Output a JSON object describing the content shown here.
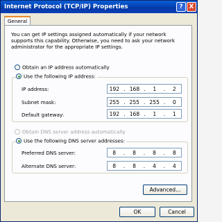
{
  "window": {
    "title": "Internet Protocol (TCP/IP) Properties",
    "help_label": "?",
    "close_label": "X"
  },
  "tabs": [
    {
      "label": "General"
    }
  ],
  "info_text": "You can get IP settings assigned automatically if your network supports this capability. Otherwise, you need to ask your network administrator for the appropriate IP settings.",
  "ip": {
    "auto_label": "Obtain an IP address automatically",
    "manual_label": "Use the following IP address:",
    "selected": "manual",
    "fields": [
      {
        "label": "IP address:",
        "octets": [
          "192",
          "168",
          "1",
          "2"
        ]
      },
      {
        "label": "Subnet mask:",
        "octets": [
          "255",
          "255",
          "255",
          "0"
        ]
      },
      {
        "label": "Default gateway:",
        "octets": [
          "192",
          "168",
          "1",
          "1"
        ]
      }
    ]
  },
  "dns": {
    "auto_label": "Obtain DNS server address automatically",
    "manual_label": "Use the following DNS server addresses:",
    "selected": "manual",
    "fields": [
      {
        "label": "Preferred DNS server:",
        "octets": [
          "8",
          "8",
          "8",
          "8"
        ]
      },
      {
        "label": "Alternate DNS server:",
        "octets": [
          "8",
          "8",
          "4",
          "4"
        ]
      }
    ]
  },
  "buttons": {
    "advanced": "Advanced...",
    "ok": "OK",
    "cancel": "Cancel"
  },
  "colors": {
    "titlebar": "#0339a8",
    "window_bg": "#ece9d8",
    "panel_bg": "#fcfcfe",
    "radio_dot": "#2f9a2f"
  }
}
